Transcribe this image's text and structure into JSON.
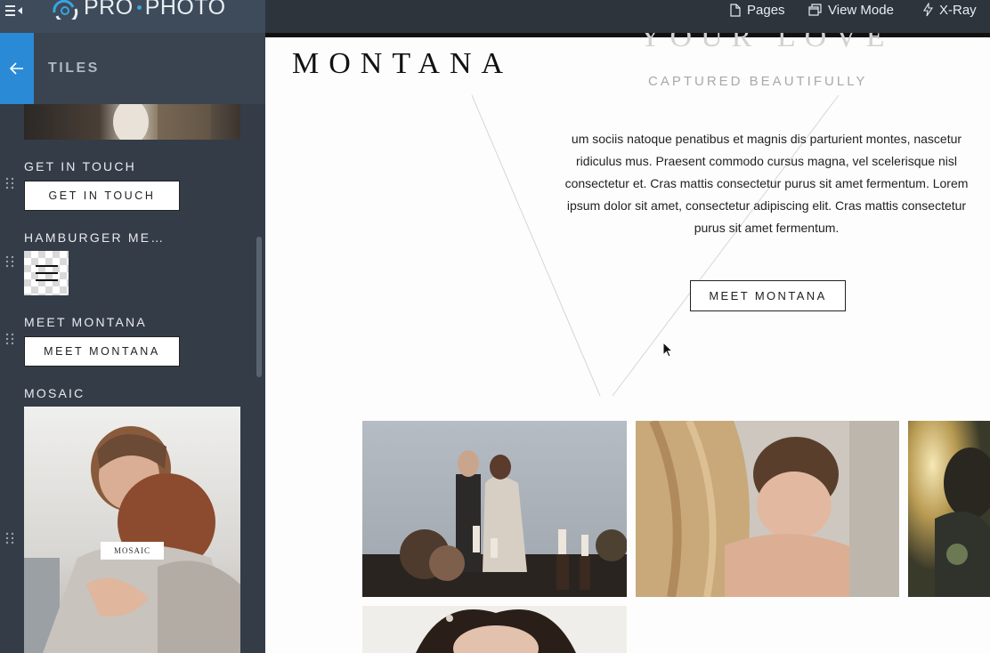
{
  "topbar": {
    "logo_text_a": "PRO",
    "logo_text_b": "PHOTO",
    "pages_label": "Pages",
    "view_mode_label": "View Mode",
    "xray_label": "X-Ray"
  },
  "sidebar": {
    "title": "TILES",
    "tiles": [
      {
        "label": "GET IN TOUCH",
        "button": "GET IN TOUCH"
      },
      {
        "label": "HAMBURGER ME…"
      },
      {
        "label": "MEET MONTANA",
        "button": "MEET MONTANA"
      },
      {
        "label": "MOSAIC",
        "caption": "MOSAIC"
      }
    ]
  },
  "canvas": {
    "brand": "MONTANA",
    "faded_heading": "YOUR LOVE",
    "tagline": "CAPTURED BEAUTIFULLY",
    "paragraph": "um sociis natoque penatibus et magnis dis parturient montes, nascetur ridiculus mus. Praesent commodo cursus magna, vel scelerisque nisl consectetur et. Cras mattis consectetur purus sit amet fermentum. Lorem ipsum dolor sit amet, consectetur adipiscing elit. Cras mattis consectetur purus sit amet fermentum.",
    "cta": "MEET MONTANA"
  },
  "colors": {
    "accent": "#2a8ad6",
    "sidebar_bg": "#343c47",
    "topbar_bg": "#2e343c"
  },
  "icons": [
    "hamburger-collapse-icon",
    "pro-photo-logo-icon",
    "page-icon",
    "window-icon",
    "lightning-icon",
    "back-arrow-icon",
    "drag-handle-icon",
    "mouse-cursor-icon"
  ]
}
